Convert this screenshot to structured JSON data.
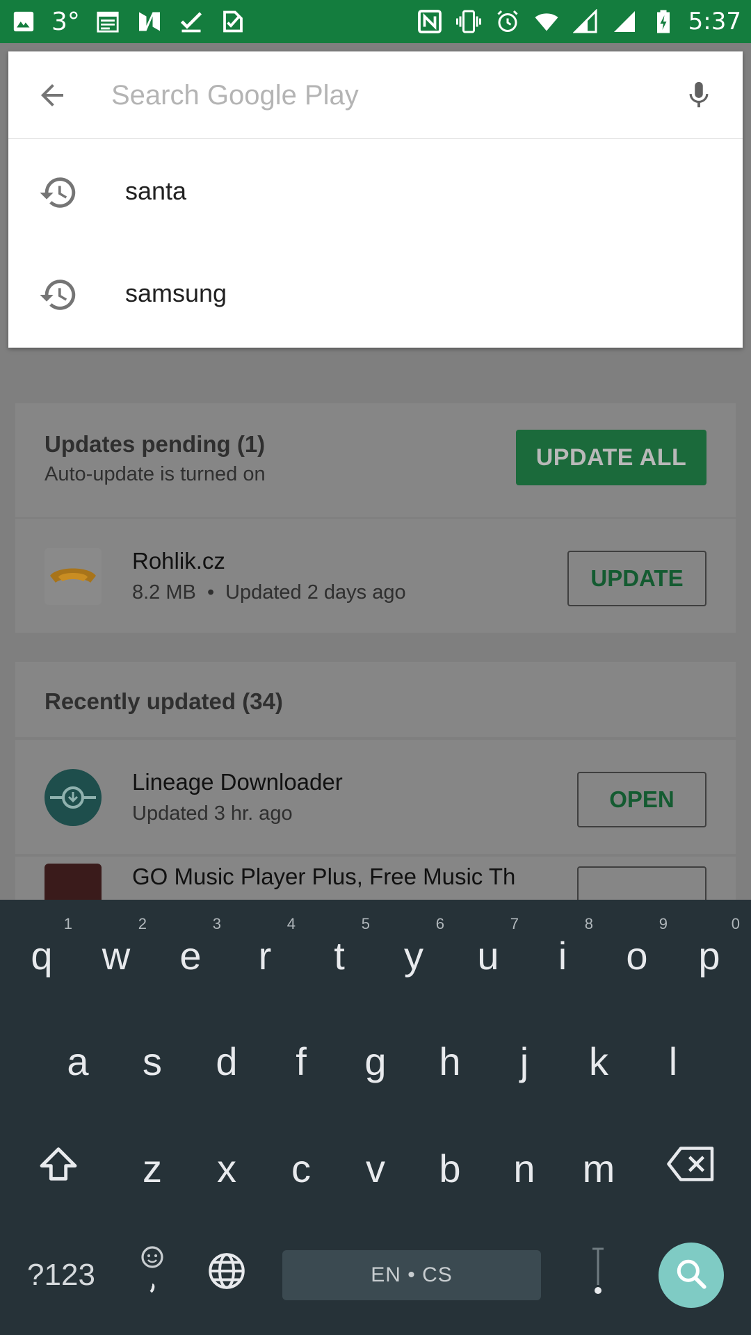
{
  "status_bar": {
    "temperature": "3°",
    "time": "5:37",
    "left_icons": [
      "image-icon",
      "calendar-icon",
      "n-app-icon",
      "check-icon",
      "tasks-icon"
    ],
    "right_icons": [
      "nfc-icon",
      "vibrate-icon",
      "alarm-icon",
      "wifi-icon",
      "signal-icon",
      "signal-icon",
      "battery-charging-icon"
    ],
    "background_color": "#147d3e"
  },
  "search": {
    "placeholder": "Search Google Play",
    "value": "",
    "suggestions": [
      {
        "label": "santa",
        "icon": "history-icon"
      },
      {
        "label": "samsung",
        "icon": "history-icon"
      }
    ]
  },
  "updates": {
    "pending_title": "Updates pending (1)",
    "pending_sub": "Auto-update is turned on",
    "update_all_label": "UPDATE ALL",
    "pending_apps": [
      {
        "name": "Rohlik.cz",
        "size": "8.2 MB",
        "separator": "•",
        "updated": "Updated 2 days ago",
        "button": "UPDATE"
      }
    ],
    "recent_title": "Recently updated (34)",
    "recent_apps": [
      {
        "name": "Lineage Downloader",
        "updated": "Updated 3 hr. ago",
        "button": "OPEN"
      },
      {
        "name": "GO Music Player Plus, Free Music Th",
        "updated": "",
        "button": ""
      }
    ]
  },
  "keyboard": {
    "row1": [
      {
        "key": "q",
        "hint": "1"
      },
      {
        "key": "w",
        "hint": "2"
      },
      {
        "key": "e",
        "hint": "3"
      },
      {
        "key": "r",
        "hint": "4"
      },
      {
        "key": "t",
        "hint": "5"
      },
      {
        "key": "y",
        "hint": "6"
      },
      {
        "key": "u",
        "hint": "7"
      },
      {
        "key": "i",
        "hint": "8"
      },
      {
        "key": "o",
        "hint": "9"
      },
      {
        "key": "p",
        "hint": "0"
      }
    ],
    "row2": [
      "a",
      "s",
      "d",
      "f",
      "g",
      "h",
      "j",
      "k",
      "l"
    ],
    "row3": [
      "z",
      "x",
      "c",
      "v",
      "b",
      "n",
      "m"
    ],
    "symbols_label": "?123",
    "space_label": "EN • CS",
    "accent_color": "#7fcbc4"
  }
}
